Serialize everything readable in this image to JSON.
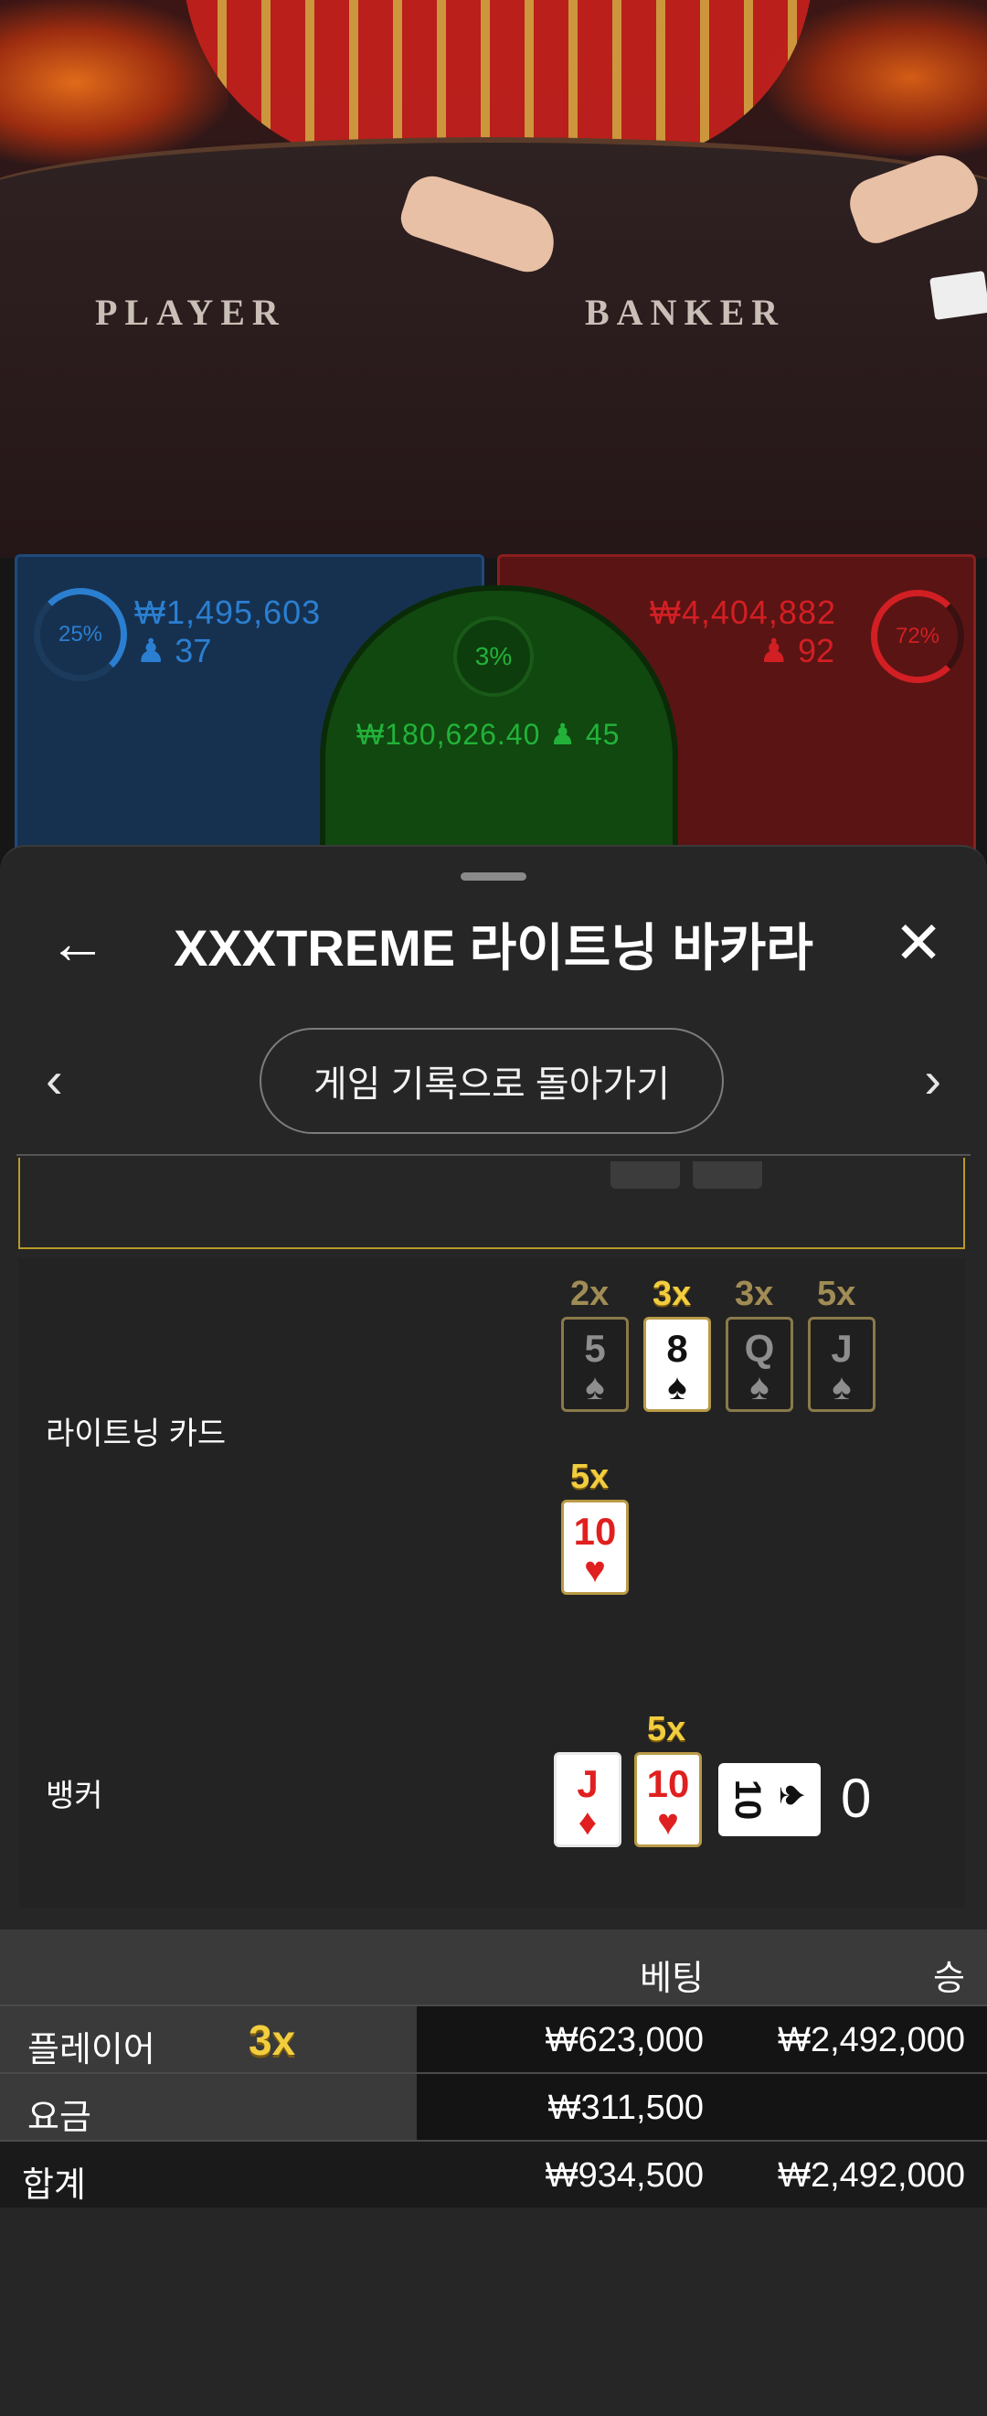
{
  "table": {
    "player_word": "PLAYER",
    "banker_word": "BANKER"
  },
  "bets_overview": {
    "player": {
      "percent": "25%",
      "amount": "₩1,495,603",
      "players": "37",
      "color": "#2b7fd1"
    },
    "tie": {
      "percent": "3%",
      "amount": "₩180,626.40",
      "players": "45",
      "color": "#22b23a"
    },
    "banker": {
      "percent": "72%",
      "amount": "₩4,404,882",
      "players": "92",
      "color": "#d21f23"
    }
  },
  "sheet": {
    "title": "XXXTREME 라이트닝 바카라",
    "back_to_history": "게임 기록으로 돌아가기"
  },
  "lightning": {
    "label": "라이트닝 카드",
    "cards": [
      {
        "rank": "5",
        "suit": "♠",
        "mult": "2x"
      },
      {
        "rank": "8",
        "suit": "♠",
        "mult": "3x"
      },
      {
        "rank": "Q",
        "suit": "♠",
        "mult": "3x"
      },
      {
        "rank": "J",
        "suit": "♠",
        "mult": "5x"
      },
      {
        "rank": "10",
        "suit": "♥",
        "mult": "5x"
      }
    ]
  },
  "banker": {
    "label": "뱅커",
    "cards": [
      {
        "rank": "J",
        "suit": "♦"
      },
      {
        "rank": "10",
        "suit": "♥",
        "mult": "5x"
      },
      {
        "rank": "10",
        "suit": "♠"
      }
    ],
    "score": "0"
  },
  "bets_table": {
    "headers": {
      "bet": "베팅",
      "win": "승"
    },
    "rows": [
      {
        "name": "플레이어",
        "mult": "3x",
        "bet": "₩623,000",
        "win": "₩2,492,000"
      },
      {
        "name": "요금",
        "bet": "₩311,500",
        "win": ""
      }
    ],
    "total": {
      "name": "합계",
      "bet": "₩934,500",
      "win": "₩2,492,000"
    }
  }
}
